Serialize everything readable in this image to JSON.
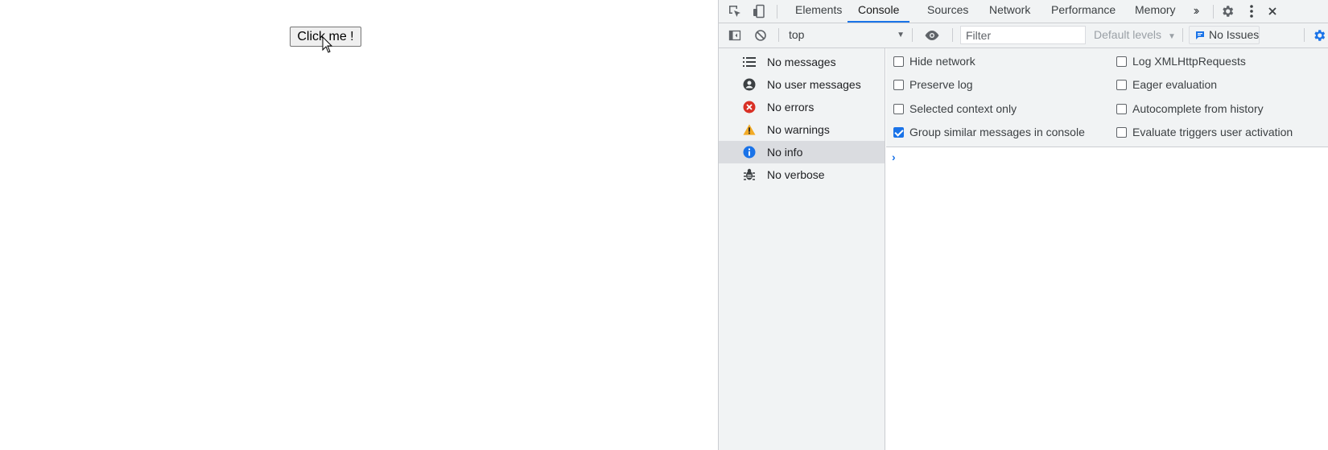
{
  "page": {
    "button_label": "Click me !"
  },
  "devtools": {
    "tabs": [
      {
        "label": "Elements"
      },
      {
        "label": "Console"
      },
      {
        "label": "Sources"
      },
      {
        "label": "Network"
      },
      {
        "label": "Performance"
      },
      {
        "label": "Memory"
      }
    ],
    "active_tab": "Console",
    "toolbar": {
      "context": "top",
      "filter_placeholder": "Filter",
      "levels_label": "Default levels",
      "issues_label": "No Issues"
    },
    "sidebar": {
      "items": [
        {
          "label": "No messages",
          "icon": "list-icon"
        },
        {
          "label": "No user messages",
          "icon": "user-icon"
        },
        {
          "label": "No errors",
          "icon": "error-icon"
        },
        {
          "label": "No warnings",
          "icon": "warning-icon"
        },
        {
          "label": "No info",
          "icon": "info-icon"
        },
        {
          "label": "No verbose",
          "icon": "bug-icon"
        }
      ],
      "selected": "No info"
    },
    "settings": {
      "left": [
        {
          "label": "Hide network",
          "checked": false
        },
        {
          "label": "Preserve log",
          "checked": false
        },
        {
          "label": "Selected context only",
          "checked": false
        },
        {
          "label": "Group similar messages in console",
          "checked": true
        }
      ],
      "right": [
        {
          "label": "Log XMLHttpRequests",
          "checked": false
        },
        {
          "label": "Eager evaluation",
          "checked": false
        },
        {
          "label": "Autocomplete from history",
          "checked": false
        },
        {
          "label": "Evaluate triggers user activation",
          "checked": false
        }
      ]
    },
    "colors": {
      "accent": "#1a73e8",
      "error": "#d93025",
      "warning": "#f2ab26",
      "info": "#1a73e8"
    }
  }
}
